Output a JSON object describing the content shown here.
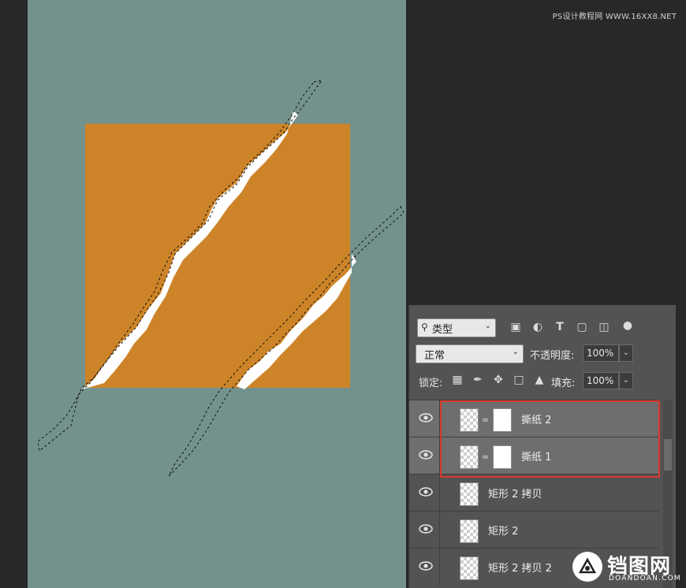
{
  "watermark_top": "PS设计教程网 WWW.16XX8.NET",
  "layers_panel": {
    "filter": {
      "label": "类型",
      "icon": "search-icon"
    },
    "filter_icons": [
      "image-filter-icon",
      "adjustment-filter-icon",
      "type-filter-icon",
      "shape-filter-icon",
      "smart-object-filter-icon",
      "filter-toggle-icon"
    ],
    "blend_mode": "正常",
    "opacity_label": "不透明度:",
    "opacity_value": "100%",
    "lock_label": "锁定:",
    "lock_icons": [
      "lock-transparent-icon",
      "lock-paint-icon",
      "lock-position-icon",
      "lock-artboard-icon",
      "lock-all-icon"
    ],
    "fill_label": "填充:",
    "fill_value": "100%",
    "layers": [
      {
        "name": "撕纸 2",
        "selected": true,
        "visible": true
      },
      {
        "name": "撕纸 1",
        "selected": false,
        "visible": true
      },
      {
        "name": "矩形 2 拷贝",
        "selected": false,
        "visible": true
      },
      {
        "name": "矩形 2",
        "selected": false,
        "visible": true
      },
      {
        "name": "矩形 2 拷贝 2",
        "selected": false,
        "visible": true
      }
    ]
  },
  "logo": {
    "name": "铛图网",
    "sub": "DOANDOAN.COM"
  },
  "colors": {
    "canvas_bg": "#74928c",
    "rect": "#cd8428",
    "highlight": "#d9392b",
    "panel": "#535353"
  }
}
